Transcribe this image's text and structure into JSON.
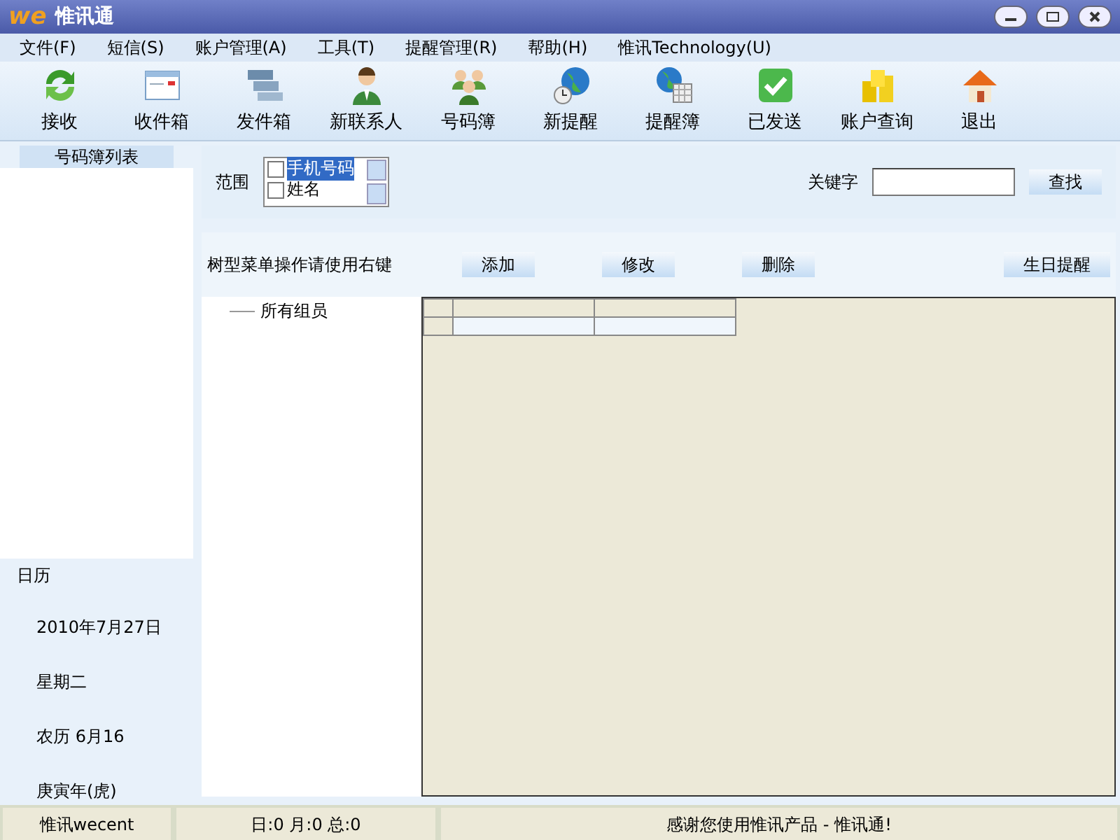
{
  "window": {
    "logo": "we",
    "title": "惟讯通"
  },
  "menu": [
    "文件(F)",
    "短信(S)",
    "账户管理(A)",
    "工具(T)",
    "提醒管理(R)",
    "帮助(H)",
    "惟讯Technology(U)"
  ],
  "toolbar": [
    {
      "kind": "refresh",
      "label": "接收"
    },
    {
      "kind": "inbox",
      "label": "收件箱"
    },
    {
      "kind": "outbox",
      "label": "发件箱"
    },
    {
      "kind": "person",
      "label": "新联系人"
    },
    {
      "kind": "people",
      "label": "号码簿"
    },
    {
      "kind": "globe",
      "label": "新提醒"
    },
    {
      "kind": "globecal",
      "label": "提醒簿"
    },
    {
      "kind": "check",
      "label": "已发送"
    },
    {
      "kind": "coins",
      "label": "账户查询"
    },
    {
      "kind": "home",
      "label": "退出"
    }
  ],
  "sidebar": {
    "header": "号码簿列表",
    "calendar_title": "日历",
    "calendar": [
      "2010年7月27日",
      "星期二",
      "农历 6月16",
      "庚寅年(虎)"
    ]
  },
  "search": {
    "scope_label": "范围",
    "scope_options": [
      {
        "label": "手机号码",
        "checked": false,
        "selected": true
      },
      {
        "label": "姓名",
        "checked": false,
        "selected": false
      }
    ],
    "keyword_label": "关键字",
    "find_button": "查找"
  },
  "actions": {
    "hint": "树型菜单操作请使用右键",
    "buttons": [
      "添加",
      "修改",
      "删除"
    ],
    "birthday_button": "生日提醒"
  },
  "tree": {
    "items": [
      "所有组员"
    ]
  },
  "status_bar": [
    "惟讯wecent",
    "日:0 月:0 总:0",
    "感谢您使用惟讯产品 - 惟讯通!"
  ]
}
